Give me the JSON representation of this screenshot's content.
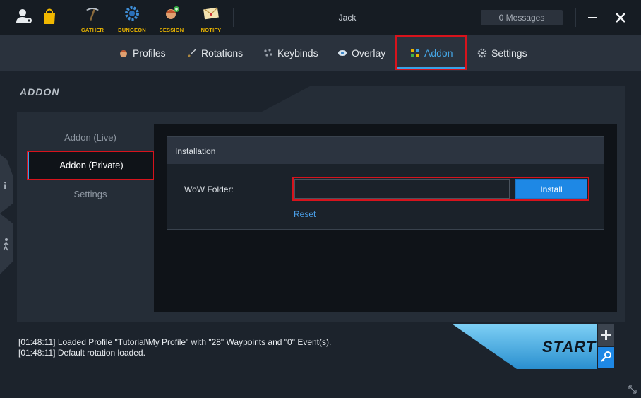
{
  "header": {
    "username": "Jack",
    "messages": "0 Messages",
    "tools": [
      {
        "label": "GATHER",
        "icon": "pickaxe-icon"
      },
      {
        "label": "DUNGEON",
        "icon": "gear-icon"
      },
      {
        "label": "SESSION",
        "icon": "character-icon"
      },
      {
        "label": "NOTIFY",
        "icon": "envelope-icon"
      }
    ]
  },
  "nav": {
    "tabs": [
      {
        "label": "Profiles",
        "icon": "profiles-icon"
      },
      {
        "label": "Rotations",
        "icon": "sword-icon"
      },
      {
        "label": "Keybinds",
        "icon": "keybinds-icon"
      },
      {
        "label": "Overlay",
        "icon": "eye-icon"
      },
      {
        "label": "Addon",
        "icon": "addon-icon"
      },
      {
        "label": "Settings",
        "icon": "cog-icon"
      }
    ],
    "active": "Addon"
  },
  "section": {
    "title": "ADDON"
  },
  "sidebar": {
    "items": [
      {
        "label": "Addon (Live)"
      },
      {
        "label": "Addon (Private)"
      },
      {
        "label": "Settings"
      }
    ],
    "selected": "Addon (Private)"
  },
  "installation": {
    "title": "Installation",
    "folder_label": "WoW Folder:",
    "folder_value": "",
    "install_label": "Install",
    "reset_label": "Reset"
  },
  "log": {
    "lines": [
      "[01:48:11] Loaded Profile \"Tutorial\\My Profile\" with \"28\" Waypoints and \"0\" Event(s).",
      "[01:48:11] Default rotation loaded."
    ]
  },
  "footer": {
    "start_label": "START"
  },
  "colors": {
    "accent": "#1e88e5",
    "highlight": "#d7131c",
    "tool_label": "#e9b400"
  }
}
